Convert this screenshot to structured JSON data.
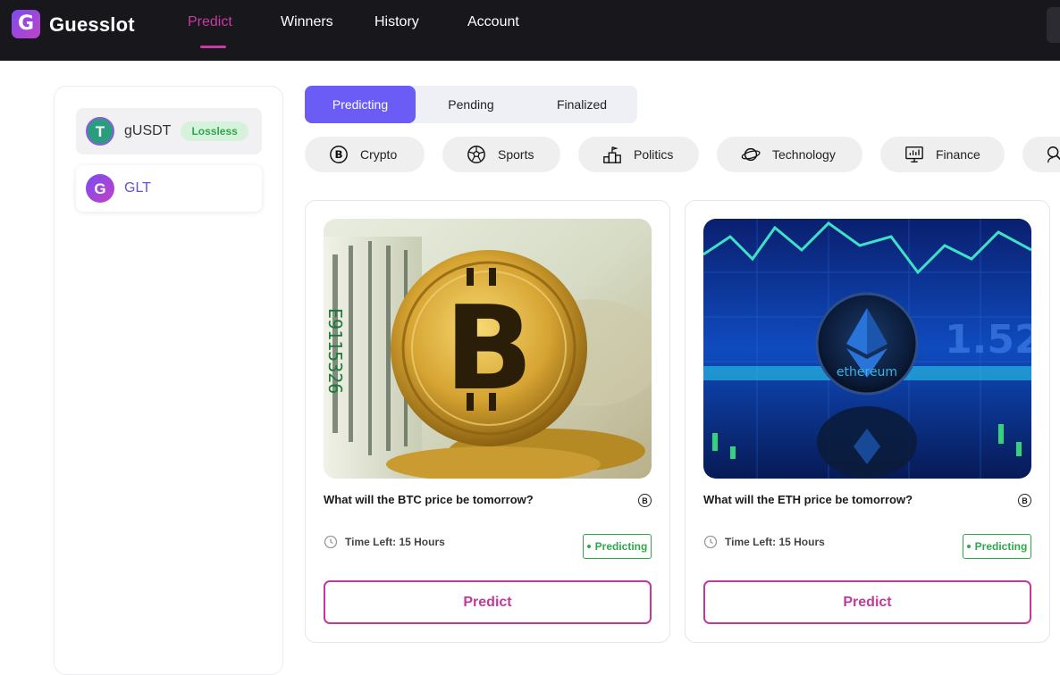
{
  "header": {
    "brand": "Guesslot",
    "logo_letter": "G",
    "nav": [
      {
        "label": "Predict",
        "active": true
      },
      {
        "label": "Winners"
      },
      {
        "label": "History"
      },
      {
        "label": "Account"
      }
    ]
  },
  "sidebar": {
    "tokens": [
      {
        "symbol": "gUSDT",
        "badge": "Lossless",
        "icon": "tether-icon",
        "icon_letter": "T",
        "selected": true
      },
      {
        "symbol": "GLT",
        "icon": "guesslot-token-icon",
        "icon_letter": "G"
      }
    ]
  },
  "status_tabs": [
    {
      "label": "Predicting",
      "active": true
    },
    {
      "label": "Pending"
    },
    {
      "label": "Finalized"
    }
  ],
  "categories": [
    {
      "label": "Crypto",
      "icon": "bitcoin-icon"
    },
    {
      "label": "Sports",
      "icon": "soccer-ball-icon"
    },
    {
      "label": "Politics",
      "icon": "podium-icon"
    },
    {
      "label": "Technology",
      "icon": "planet-icon"
    },
    {
      "label": "Finance",
      "icon": "monitor-chart-icon"
    },
    {
      "label": "",
      "icon": "search-person-icon"
    }
  ],
  "cards": [
    {
      "title": "What will the BTC price be tomorrow?",
      "image": "bitcoin-coin-on-dollar-bills",
      "coin_symbol": "B",
      "time_left": "Time Left: 15 Hours",
      "status": "Predicting",
      "button": "Predict"
    },
    {
      "title": "What will the ETH price be tomorrow?",
      "image": "ethereum-coin-with-blue-chart",
      "coin_symbol": "B",
      "time_left": "Time Left: 15 Hours",
      "status": "Predicting",
      "button": "Predict"
    }
  ],
  "colors": {
    "accent": "#c93aa8",
    "tab_active": "#6b5cf5",
    "status_green": "#2fa84b",
    "topbar": "#17171c"
  }
}
